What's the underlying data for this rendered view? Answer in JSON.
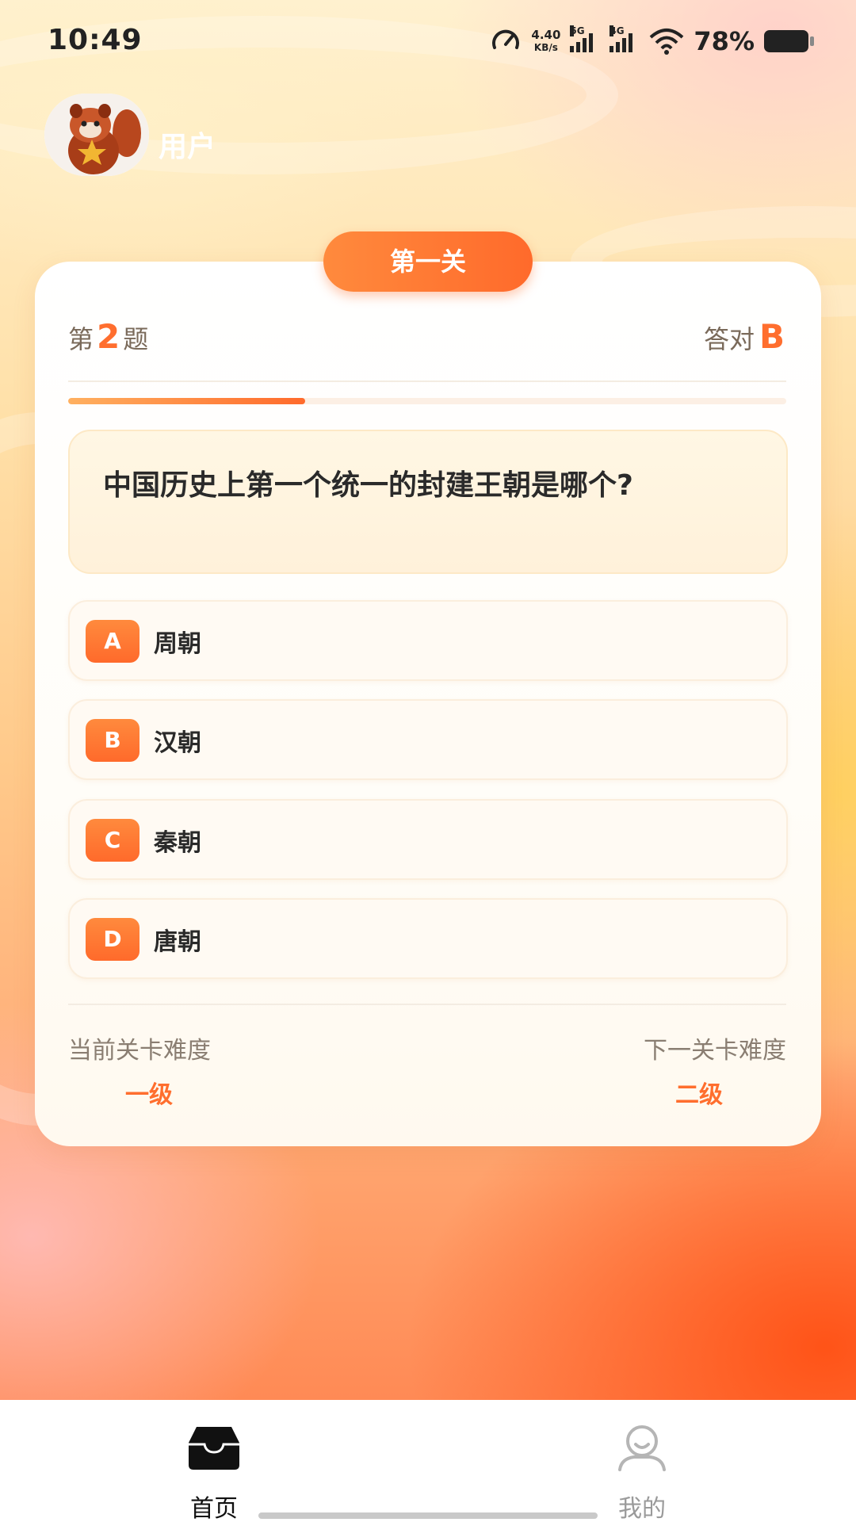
{
  "status_bar": {
    "time": "10:49",
    "net_speed_value": "4.40",
    "net_speed_unit": "KB/s",
    "signal_1_label": "5G",
    "signal_2_label": "4G",
    "battery": "78%"
  },
  "user": {
    "name": "用户",
    "avatar_icon": "red-panda-avatar"
  },
  "level": {
    "title": "第一关"
  },
  "quiz": {
    "question_prefix": "第",
    "question_number": "2",
    "question_suffix": "题",
    "answer_label": "答对",
    "answer_value": "B",
    "progress_fraction": 0.33,
    "question_text": "中国历史上第一个统一的封建王朝是哪个?",
    "options": [
      {
        "letter": "A",
        "text": "周朝"
      },
      {
        "letter": "B",
        "text": "汉朝"
      },
      {
        "letter": "C",
        "text": "秦朝"
      },
      {
        "letter": "D",
        "text": "唐朝"
      }
    ]
  },
  "difficulty": {
    "current_label": "当前关卡难度",
    "current_value": "一级",
    "next_label": "下一关卡难度",
    "next_value": "二级"
  },
  "nav": {
    "home_label": "首页",
    "home_icon": "inbox-icon",
    "mine_label": "我的",
    "mine_icon": "user-icon"
  },
  "colors": {
    "accent": "#ff6e2e",
    "accent_light": "#ff8a3d"
  }
}
